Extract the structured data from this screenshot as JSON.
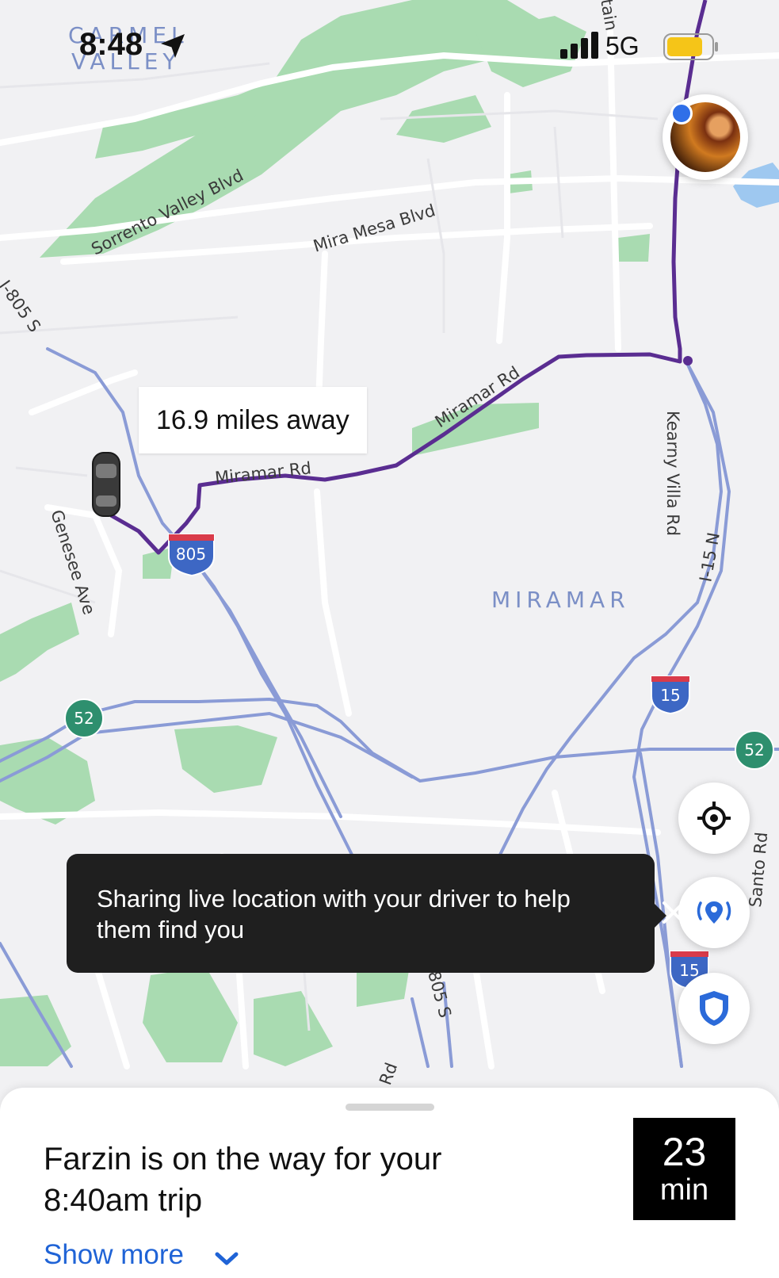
{
  "status_bar": {
    "time": "8:48",
    "network": "5G",
    "battery_color": "#f5c518"
  },
  "map": {
    "area_labels": {
      "carmel": "CARMEL",
      "valley": "VALLEY",
      "miramar": "MIRAMAR"
    },
    "streets": {
      "sorrento": "Sorrento Valley Blvd",
      "mira_mesa": "Mira Mesa Blvd",
      "i805s_top": "I-805 S",
      "miramar_rd_1": "Miramar Rd",
      "miramar_rd_2": "Miramar Rd",
      "genesee": "Genesee Ave",
      "kearny": "Kearny Villa Rd",
      "i15n": "I-15 N",
      "santo": "Santo Rd",
      "i805s_bottom": "805 S",
      "rd_bottom": "Rd",
      "mountain": "tain"
    },
    "shields": {
      "i805": "805",
      "i15_a": "15",
      "i15_b": "15",
      "sr52_left": "52",
      "sr52_right": "52"
    },
    "route_color": "#5a2d91"
  },
  "distance_label": "16.9 miles away",
  "tooltip": {
    "text": "Sharing live location with your driver to help them find you"
  },
  "sheet": {
    "title": "Farzin is on the way for your 8:40am trip",
    "eta_value": "23",
    "eta_unit": "min",
    "show_more": "Show more"
  }
}
